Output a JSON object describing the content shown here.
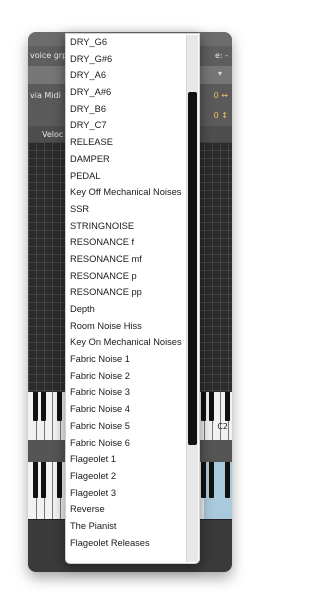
{
  "menu": {
    "items": [
      "DRY_G6",
      "DRY_G#6",
      "DRY_A6",
      "DRY_A#6",
      "DRY_B6",
      "DRY_C7",
      "RELEASE",
      "DAMPER",
      "PEDAL",
      "Key Off Mechanical Noises",
      "SSR",
      "STRINGNOISE",
      "RESONANCE f",
      "RESONANCE mf",
      "RESONANCE p",
      "RESONANCE pp",
      "Depth",
      "Room Noise Hiss",
      "Key On Mechanical Noises",
      "Fabric Noise 1",
      "Fabric Noise 2",
      "Fabric Noise 3",
      "Fabric Noise 4",
      "Fabric Noise 5",
      "Fabric Noise 6",
      "Flageolet 1",
      "Flageolet 2",
      "Flageolet 3",
      "Reverse",
      "The Pianist",
      "Flageolet Releases"
    ],
    "scroll_position": 0.33,
    "scroll_visible_fraction": 0.67
  },
  "background": {
    "group_label": "voice grp.",
    "edit_label": "e: -",
    "midi_label": "via Midi",
    "velocity_label": "Veloc",
    "keyboard_label": "C2",
    "arrows_1": "0 ↔",
    "arrows_2": "0 ↕"
  },
  "colors": {
    "scroll_thumb": "#111111",
    "menu_bg": "#ffffff"
  }
}
